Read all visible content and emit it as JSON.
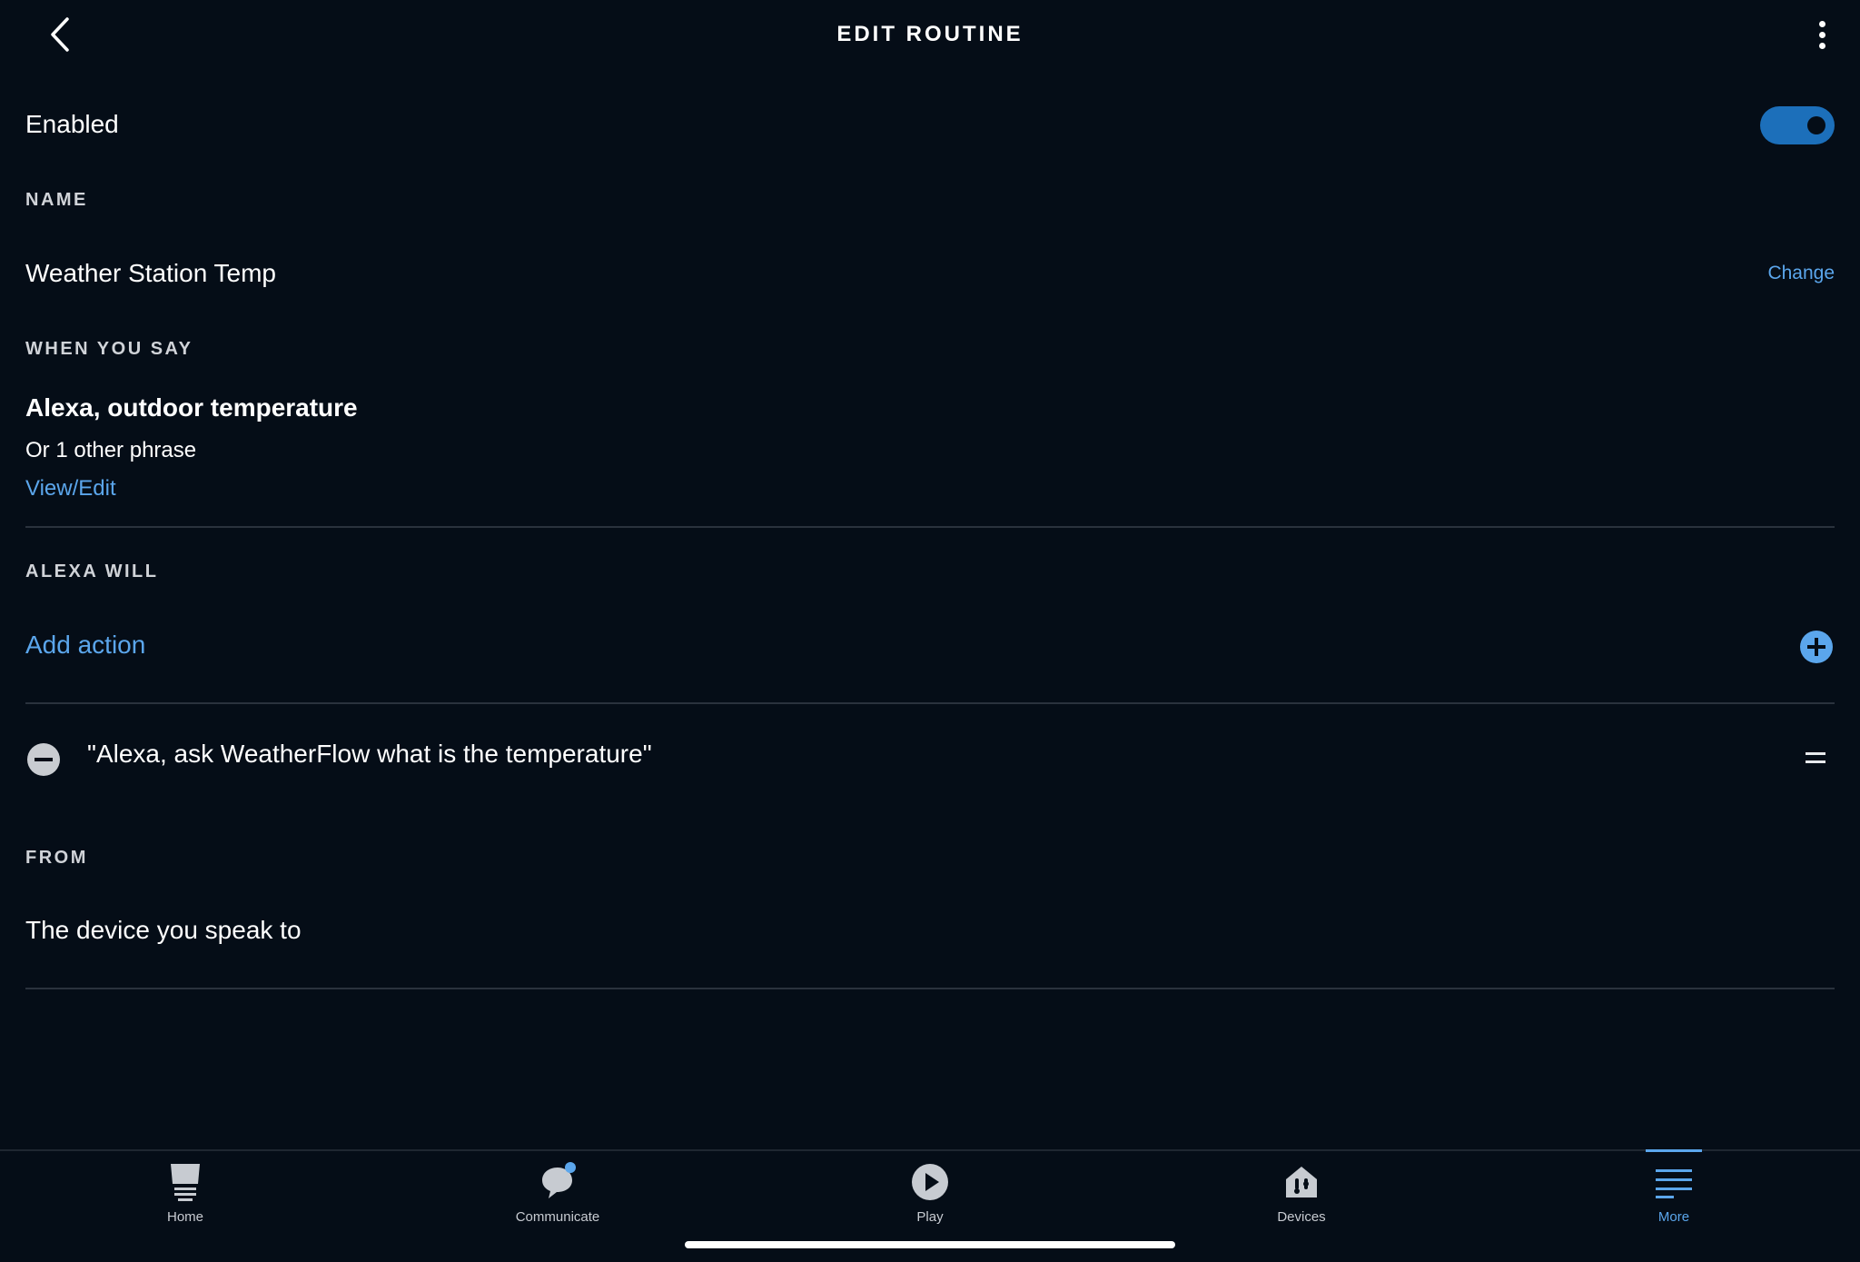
{
  "header": {
    "title": "EDIT ROUTINE"
  },
  "enabled": {
    "label": "Enabled",
    "state": "on",
    "accent": "#1c6fba"
  },
  "name_section": {
    "label": "NAME",
    "value": "Weather Station Temp",
    "change_link": "Change"
  },
  "when_you_say": {
    "label": "WHEN YOU SAY",
    "phrase": "Alexa, outdoor temperature",
    "other": "Or 1 other phrase",
    "view_edit": "View/Edit"
  },
  "alexa_will": {
    "label": "ALEXA WILL",
    "add_action": "Add action",
    "actions": [
      {
        "text": "\"Alexa, ask WeatherFlow what is the temperature\""
      }
    ]
  },
  "from_section": {
    "label": "FROM",
    "value": "The device you speak to"
  },
  "bottom_nav": {
    "items": [
      {
        "label": "Home",
        "icon": "home-icon"
      },
      {
        "label": "Communicate",
        "icon": "chat-bubble-icon"
      },
      {
        "label": "Play",
        "icon": "play-icon"
      },
      {
        "label": "Devices",
        "icon": "devices-house-icon"
      },
      {
        "label": "More",
        "icon": "menu-lines-icon",
        "active": true
      }
    ]
  },
  "colors": {
    "background": "#050d17",
    "link": "#5ba6ec",
    "divider": "#2a323d"
  }
}
